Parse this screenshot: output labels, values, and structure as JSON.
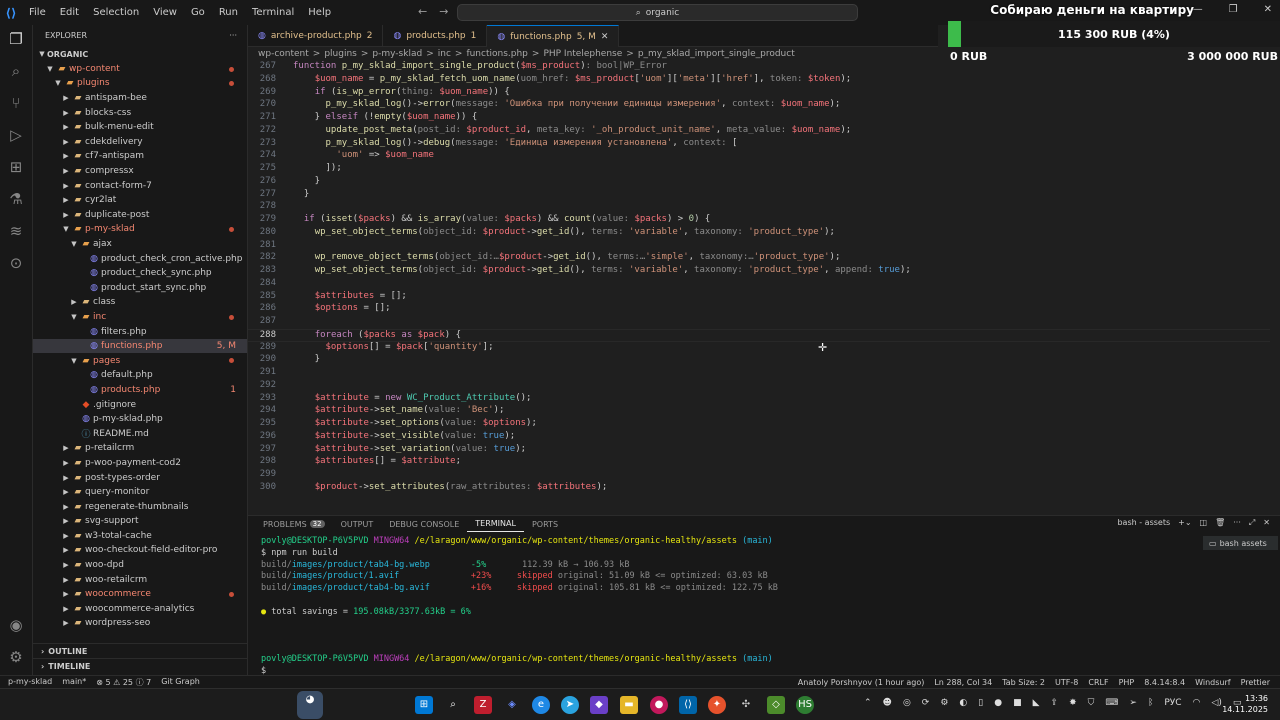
{
  "titlebar": {
    "menu": [
      "File",
      "Edit",
      "Selection",
      "View",
      "Go",
      "Run",
      "Terminal",
      "Help"
    ],
    "search": "organic"
  },
  "explorer": {
    "header": "EXPLORER",
    "root": "ORGANIC",
    "items": [
      {
        "depth": 1,
        "type": "folder",
        "open": true,
        "name": "wp-content",
        "color": "#f48771",
        "dot": true
      },
      {
        "depth": 2,
        "type": "folder",
        "open": true,
        "name": "plugins",
        "color": "#f48771",
        "dot": true
      },
      {
        "depth": 3,
        "type": "folder",
        "name": "antispam-bee"
      },
      {
        "depth": 3,
        "type": "folder",
        "name": "blocks-css"
      },
      {
        "depth": 3,
        "type": "folder",
        "name": "bulk-menu-edit"
      },
      {
        "depth": 3,
        "type": "folder",
        "name": "cdekdelivery"
      },
      {
        "depth": 3,
        "type": "folder",
        "name": "cf7-antispam"
      },
      {
        "depth": 3,
        "type": "folder",
        "name": "compressx"
      },
      {
        "depth": 3,
        "type": "folder",
        "name": "contact-form-7"
      },
      {
        "depth": 3,
        "type": "folder",
        "name": "cyr2lat"
      },
      {
        "depth": 3,
        "type": "folder",
        "name": "duplicate-post"
      },
      {
        "depth": 3,
        "type": "folder",
        "open": true,
        "name": "p-my-sklad",
        "color": "#f48771",
        "dot": true
      },
      {
        "depth": 4,
        "type": "folder",
        "open": true,
        "name": "ajax"
      },
      {
        "depth": 5,
        "type": "php",
        "name": "product_check_cron_active.php"
      },
      {
        "depth": 5,
        "type": "php",
        "name": "product_check_sync.php"
      },
      {
        "depth": 5,
        "type": "php",
        "name": "product_start_sync.php"
      },
      {
        "depth": 4,
        "type": "folder",
        "name": "class"
      },
      {
        "depth": 4,
        "type": "folder",
        "open": true,
        "name": "inc",
        "color": "#f48771",
        "dot": true
      },
      {
        "depth": 5,
        "type": "php",
        "name": "filters.php"
      },
      {
        "depth": 5,
        "type": "php",
        "name": "functions.php",
        "color": "#f48771",
        "badge": "5, M",
        "selected": true
      },
      {
        "depth": 4,
        "type": "folder",
        "open": true,
        "name": "pages",
        "color": "#f48771",
        "dot": true
      },
      {
        "depth": 5,
        "type": "php",
        "name": "default.php"
      },
      {
        "depth": 5,
        "type": "php",
        "name": "products.php",
        "color": "#f48771",
        "badge": "1"
      },
      {
        "depth": 4,
        "type": "git",
        "name": ".gitignore"
      },
      {
        "depth": 4,
        "type": "php",
        "name": "p-my-sklad.php"
      },
      {
        "depth": 4,
        "type": "md",
        "name": "README.md"
      },
      {
        "depth": 3,
        "type": "folder",
        "name": "p-retailcrm"
      },
      {
        "depth": 3,
        "type": "folder",
        "name": "p-woo-payment-cod2"
      },
      {
        "depth": 3,
        "type": "folder",
        "name": "post-types-order"
      },
      {
        "depth": 3,
        "type": "folder",
        "name": "query-monitor"
      },
      {
        "depth": 3,
        "type": "folder",
        "name": "regenerate-thumbnails"
      },
      {
        "depth": 3,
        "type": "folder",
        "name": "svg-support"
      },
      {
        "depth": 3,
        "type": "folder",
        "name": "w3-total-cache"
      },
      {
        "depth": 3,
        "type": "folder",
        "name": "woo-checkout-field-editor-pro"
      },
      {
        "depth": 3,
        "type": "folder",
        "name": "woo-dpd"
      },
      {
        "depth": 3,
        "type": "folder",
        "name": "woo-retailcrm"
      },
      {
        "depth": 3,
        "type": "folder",
        "name": "woocommerce",
        "color": "#f48771",
        "dot": true
      },
      {
        "depth": 3,
        "type": "folder",
        "name": "woocommerce-analytics"
      },
      {
        "depth": 3,
        "type": "folder",
        "name": "wordpress-seo"
      }
    ],
    "outline": "OUTLINE",
    "timeline": "TIMELINE"
  },
  "tabs": [
    {
      "name": "archive-product.php",
      "badge": "2",
      "active": false
    },
    {
      "name": "products.php",
      "badge": "1",
      "active": false
    },
    {
      "name": "functions.php",
      "badge": "5, M",
      "active": true
    }
  ],
  "breadcrumb": [
    "wp-content",
    ">",
    "plugins",
    ">",
    "p-my-sklad",
    ">",
    "inc",
    ">",
    "functions.php",
    ">",
    "PHP Intelephense",
    ">",
    "p_my_sklad_import_single_product"
  ],
  "code": [
    {
      "n": "267",
      "h": "<span class='k'>function</span> <span class='f'>p_my_sklad_import_single_product</span>(<span class='v'>$ms_product</span>)<span class='h'>: bool|WP_Error</span>"
    },
    {
      "n": "268",
      "h": "    <span class='v'>$uom_name</span> = <span class='f'>p_my_sklad_fetch_uom_name</span>(<span class='h'>uom_href: </span><span class='v'>$ms_product</span>[<span class='s'>'uom'</span>][<span class='s'>'meta'</span>][<span class='s'>'href'</span>], <span class='h'>token: </span><span class='v'>$token</span>);"
    },
    {
      "n": "269",
      "h": "    <span class='k'>if</span> (<span class='f'>is_wp_error</span>(<span class='h'>thing: </span><span class='v'>$uom_name</span>)) {"
    },
    {
      "n": "270",
      "h": "      <span class='f'>p_my_sklad_log</span>()-&gt;<span class='f'>error</span>(<span class='h'>message: </span><span class='s'>'Ошибка при получении единицы измерения'</span>, <span class='h'>context: </span><span class='v'>$uom_name</span>);"
    },
    {
      "n": "271",
      "h": "    } <span class='k'>elseif</span> (!<span class='f'>empty</span>(<span class='v'>$uom_name</span>)) {"
    },
    {
      "n": "272",
      "h": "      <span class='f'>update_post_meta</span>(<span class='h'>post_id: </span><span class='v'>$product_id</span>, <span class='h'>meta_key: </span><span class='s'>'_oh_product_unit_name'</span>, <span class='h'>meta_value: </span><span class='v'>$uom_name</span>);"
    },
    {
      "n": "273",
      "h": "      <span class='f'>p_my_sklad_log</span>()-&gt;<span class='f'>debug</span>(<span class='h'>message: </span><span class='s'>'Единица измерения установлена'</span>, <span class='h'>context: </span>["
    },
    {
      "n": "274",
      "h": "        <span class='s'>'uom'</span> =&gt; <span class='v'>$uom_name</span>"
    },
    {
      "n": "275",
      "h": "      ]);"
    },
    {
      "n": "276",
      "h": "    }"
    },
    {
      "n": "277",
      "h": "  }"
    },
    {
      "n": "278",
      "h": ""
    },
    {
      "n": "279",
      "h": "  <span class='k'>if</span> (<span class='f'>isset</span>(<span class='v'>$packs</span>) &amp;&amp; <span class='f'>is_array</span>(<span class='h'>value: </span><span class='v'>$packs</span>) &amp;&amp; <span class='f'>count</span>(<span class='h'>value: </span><span class='v'>$packs</span>) &gt; <span class='n'>0</span>) {"
    },
    {
      "n": "280",
      "h": "    <span class='f'>wp_set_object_terms</span>(<span class='h'>object_id: </span><span class='v'>$product</span>-&gt;<span class='f'>get_id</span>(), <span class='h'>terms: </span><span class='s'>'variable'</span>, <span class='h'>taxonomy: </span><span class='s'>'product_type'</span>);"
    },
    {
      "n": "281",
      "h": ""
    },
    {
      "n": "282",
      "h": "    <span class='f'>wp_remove_object_terms</span>(<span class='h'>object_id:…</span><span class='v'>$product</span>-&gt;<span class='f'>get_id</span>(), <span class='h'>terms:…</span><span class='s'>'simple'</span>, <span class='h'>taxonomy:…</span><span class='s'>'product_type'</span>);"
    },
    {
      "n": "283",
      "h": "    <span class='f'>wp_set_object_terms</span>(<span class='h'>object_id: </span><span class='v'>$product</span>-&gt;<span class='f'>get_id</span>(), <span class='h'>terms: </span><span class='s'>'variable'</span>, <span class='h'>taxonomy: </span><span class='s'>'product_type'</span>, <span class='h'>append: </span><span class='b'>true</span>);"
    },
    {
      "n": "284",
      "h": ""
    },
    {
      "n": "285",
      "h": "    <span class='v'>$attributes</span> = [];"
    },
    {
      "n": "286",
      "h": "    <span class='v'>$options</span> = [];"
    },
    {
      "n": "287",
      "h": ""
    },
    {
      "n": "288",
      "h": "    <span class='k'>foreach</span> (<span class='v'>$packs</span> <span class='k'>as</span> <span class='v'>$pack</span>) {",
      "cur": true
    },
    {
      "n": "289",
      "h": "      <span class='v'>$options</span>[] = <span class='v'>$pack</span>[<span class='s'>'quantity'</span>];"
    },
    {
      "n": "290",
      "h": "    }"
    },
    {
      "n": "291",
      "h": ""
    },
    {
      "n": "292",
      "h": ""
    },
    {
      "n": "293",
      "h": "    <span class='v'>$attribute</span> = <span class='k'>new</span> <span class='t'>WC_Product_Attribute</span>();"
    },
    {
      "n": "294",
      "h": "    <span class='v'>$attribute</span>-&gt;<span class='f'>set_name</span>(<span class='h'>value: </span><span class='s'>'Вес'</span>);"
    },
    {
      "n": "295",
      "h": "    <span class='v'>$attribute</span>-&gt;<span class='f'>set_options</span>(<span class='h'>value: </span><span class='v'>$options</span>);"
    },
    {
      "n": "296",
      "h": "    <span class='v'>$attribute</span>-&gt;<span class='f'>set_visible</span>(<span class='h'>value: </span><span class='b'>true</span>);"
    },
    {
      "n": "297",
      "h": "    <span class='v'>$attribute</span>-&gt;<span class='f'>set_variation</span>(<span class='h'>value: </span><span class='b'>true</span>);"
    },
    {
      "n": "298",
      "h": "    <span class='v'>$attributes</span>[] = <span class='v'>$attribute</span>;"
    },
    {
      "n": "299",
      "h": ""
    },
    {
      "n": "300",
      "h": "    <span class='v'>$product</span>-&gt;<span class='f'>set_attributes</span>(<span class='h'>raw_attributes: </span><span class='v'>$attributes</span>);"
    }
  ],
  "panel": {
    "tabs": [
      "PROBLEMS",
      "OUTPUT",
      "DEBUG CONSOLE",
      "TERMINAL",
      "PORTS"
    ],
    "problems_count": "32",
    "active": "TERMINAL",
    "shell": "bash - assets",
    "term_item": "bash  assets"
  },
  "terminal": [
    "<span class='tg'>povly@DESKTOP-P6V5PVD</span> <span class='tm'>MINGW64</span> <span class='ty'>/e/laragon/www/organic/wp-content/themes/organic-healthy/assets</span> <span class='tc'>(main)</span>",
    "$ npm run build",
    "<span class='tgy'>build/</span><span class='tc'>images/product/tab4-bg.webp</span>        <span class='tg'>-5%</span>       <span class='tgy'>112.39 kB → 106.93 kB</span>",
    "<span class='tgy'>build/</span><span class='tc'>images/product/1.avif</span>              <span class='tr'>+23%</span>     <span class='tr'>skipped</span> <span class='tgy'>original: 51.09 kB &lt;= optimized: 63.03 kB</span>",
    "<span class='tgy'>build/</span><span class='tc'>images/product/tab4-bg.avif</span>        <span class='tr'>+16%</span>     <span class='tr'>skipped</span> <span class='tgy'>original: 105.81 kB &lt;= optimized: 122.75 kB</span>",
    "",
    "<span class='ty'>●</span> total savings = <span class='tg'>195.08kB/3377.63kB = 6%</span>",
    "",
    "",
    "",
    "<span class='tg'>povly@DESKTOP-P6V5PVD</span> <span class='tm'>MINGW64</span> <span class='ty'>/e/laragon/www/organic/wp-content/themes/organic-healthy/assets</span> <span class='tc'>(main)</span>",
    "$ "
  ],
  "statusbar": {
    "left": [
      "p-my-sklad",
      "main*",
      "⊗ 5 ⚠ 25 ⓘ 7",
      "Git Graph"
    ],
    "right": [
      "Anatoly Porshnyov (1 hour ago)",
      "Ln 288, Col 34",
      "Tab Size: 2",
      "UTF-8",
      "CRLF",
      "PHP",
      "8.4.14:8.4",
      "Windsurf",
      "Prettier"
    ]
  },
  "donation": {
    "title": "Собираю деньги на квартиру",
    "amount": "115 300 RUB (4%)",
    "min": "0 RUB",
    "max": "3 000 000 RUB",
    "progress": 0.04,
    "color": "#3dbb4b"
  },
  "taskbar": {
    "time": "13:36",
    "date": "14.11.2025",
    "lang": "РУС"
  }
}
